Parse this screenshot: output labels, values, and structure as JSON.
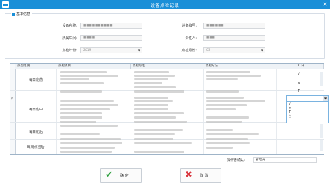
{
  "window": {
    "title": "设备点检记录",
    "close_glyph": "✕"
  },
  "basic_info": {
    "group_title": "基本信息",
    "fields": [
      {
        "label": "设备名称:",
        "value": "■■■■■■■■■■"
      },
      {
        "label": "设备编号:",
        "value": "■■■■■■"
      },
      {
        "label": "所属车间:",
        "value": "■■■■"
      },
      {
        "label": "责任人:",
        "value": "■■■"
      },
      {
        "label": "点检年份:",
        "value": "2019"
      },
      {
        "label": "点检月份:",
        "value": "03"
      }
    ]
  },
  "grid": {
    "headers": [
      "点检周期",
      "点检项目",
      "点检标准",
      "点检方法",
      "31日"
    ],
    "rows": [
      {
        "period": "每日班前",
        "day31": [
          "√",
          "×",
          "T"
        ]
      },
      {
        "period": "每日班中",
        "day31": []
      },
      {
        "period": "每日班后",
        "day31": []
      },
      {
        "period": "每周点检后",
        "day31": []
      }
    ],
    "dropdown_options": [
      "√",
      "×",
      "T",
      "△"
    ],
    "row_marker": "//"
  },
  "footer": {
    "label": "操作者确认:",
    "value": "管理员"
  },
  "buttons": {
    "ok": "确 定",
    "cancel": "取 消"
  },
  "colors": {
    "accent": "#1a8fd8",
    "ok_icon": "#2a9d3a",
    "cancel_icon": "#d9363e"
  }
}
